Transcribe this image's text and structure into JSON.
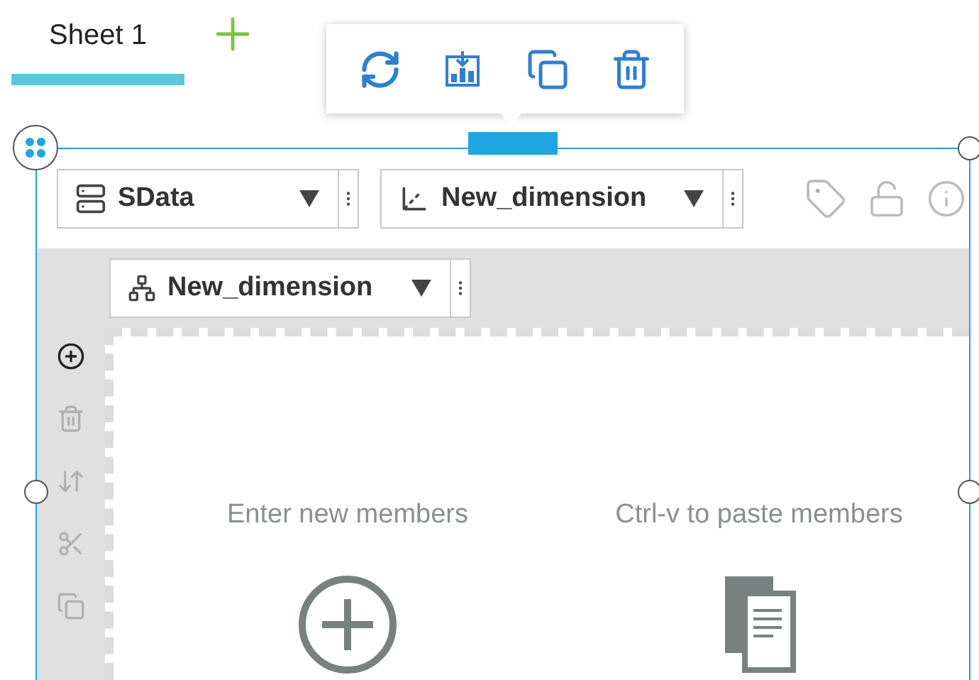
{
  "tabs": [
    {
      "label": "Sheet 1",
      "selected": true
    }
  ],
  "header": {
    "source": "SData",
    "dimension": "New_dimension"
  },
  "hierarchy": {
    "dimension": "New_dimension"
  },
  "side_tools": [
    {
      "kind": "add",
      "disabled": false
    },
    {
      "kind": "delete",
      "disabled": true
    },
    {
      "kind": "move",
      "disabled": true
    },
    {
      "kind": "cut",
      "disabled": true
    },
    {
      "kind": "copy",
      "disabled": true
    }
  ],
  "actions": [
    {
      "kind": "add",
      "label": "Enter new members"
    },
    {
      "kind": "paste",
      "label": "Ctrl-v to paste members"
    }
  ]
}
